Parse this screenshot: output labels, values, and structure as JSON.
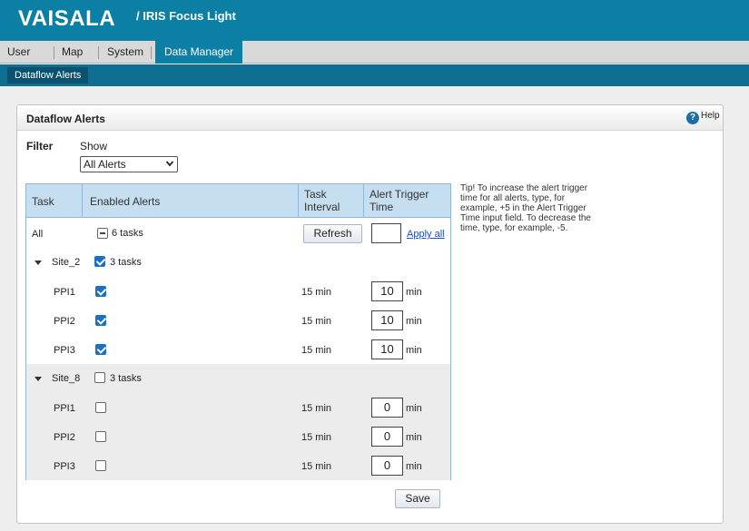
{
  "app": {
    "logo_text": "VAISALA",
    "product_name": "/ IRIS Focus Light",
    "brand_color": "#0c7fa5"
  },
  "menu": {
    "items": [
      "User",
      "Map",
      "System",
      "Data Manager"
    ],
    "active": "Data Manager"
  },
  "submenu": {
    "items": [
      "Dataflow Alerts"
    ],
    "active": "Dataflow Alerts"
  },
  "panel": {
    "title": "Dataflow Alerts",
    "help_label": "Help",
    "help_icon": "help-icon"
  },
  "filter": {
    "label": "Filter",
    "show_label": "Show",
    "selected": "All Alerts"
  },
  "tip": "Tip! To increase the alert trigger time for all alerts, type, for example, +5 in the Alert Trigger Time input field. To decrease the time, type, for example, -5.",
  "table": {
    "headers": {
      "task": "Task",
      "enabled": "Enabled Alerts",
      "interval_line1": "Task",
      "interval_line2": "Interval",
      "trigger_line1": "Alert Trigger",
      "trigger_line2": "Time"
    },
    "all_row": {
      "label": "All",
      "tasks_text": "6 tasks",
      "refresh_label": "Refresh",
      "trigger_value": "",
      "apply_all_label": "Apply all"
    },
    "groups": [
      {
        "name": "Site_2",
        "tasks_text": "3 tasks",
        "checked": true,
        "tasks": [
          {
            "name": "PPI1",
            "checked": true,
            "interval": "15 min",
            "trigger": "10",
            "unit": "min"
          },
          {
            "name": "PPI2",
            "checked": true,
            "interval": "15 min",
            "trigger": "10",
            "unit": "min"
          },
          {
            "name": "PPI3",
            "checked": true,
            "interval": "15 min",
            "trigger": "10",
            "unit": "min"
          }
        ]
      },
      {
        "name": "Site_8",
        "tasks_text": "3 tasks",
        "checked": false,
        "tasks": [
          {
            "name": "PPI1",
            "checked": false,
            "interval": "15 min",
            "trigger": "0",
            "unit": "min"
          },
          {
            "name": "PPI2",
            "checked": false,
            "interval": "15 min",
            "trigger": "0",
            "unit": "min"
          },
          {
            "name": "PPI3",
            "checked": false,
            "interval": "15 min",
            "trigger": "0",
            "unit": "min"
          }
        ]
      }
    ]
  },
  "save_label": "Save"
}
